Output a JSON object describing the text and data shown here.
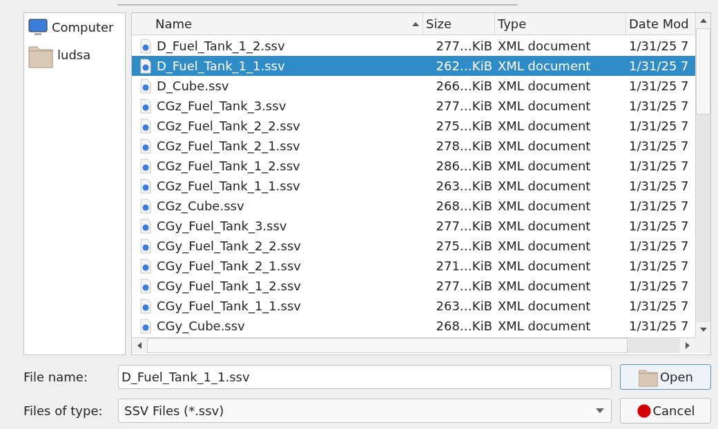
{
  "places": [
    {
      "label": "Computer",
      "kind": "computer",
      "selected": false
    },
    {
      "label": "ludsa",
      "kind": "folder",
      "selected": false
    }
  ],
  "table": {
    "columns": [
      {
        "label": "Name",
        "sorted": true
      },
      {
        "label": "Size",
        "sorted": false
      },
      {
        "label": "Type",
        "sorted": false
      },
      {
        "label": "Date Mod",
        "sorted": false
      }
    ],
    "rows": [
      {
        "name": "D_Fuel_Tank_1_2.ssv",
        "size": "277…KiB",
        "type": "XML document",
        "date": "1/31/25 7",
        "selected": false
      },
      {
        "name": "D_Fuel_Tank_1_1.ssv",
        "size": "262…KiB",
        "type": "XML document",
        "date": "1/31/25 7",
        "selected": true
      },
      {
        "name": "D_Cube.ssv",
        "size": "266…KiB",
        "type": "XML document",
        "date": "1/31/25 7",
        "selected": false
      },
      {
        "name": "CGz_Fuel_Tank_3.ssv",
        "size": "277…KiB",
        "type": "XML document",
        "date": "1/31/25 7",
        "selected": false
      },
      {
        "name": "CGz_Fuel_Tank_2_2.ssv",
        "size": "275…KiB",
        "type": "XML document",
        "date": "1/31/25 7",
        "selected": false
      },
      {
        "name": "CGz_Fuel_Tank_2_1.ssv",
        "size": "278…KiB",
        "type": "XML document",
        "date": "1/31/25 7",
        "selected": false
      },
      {
        "name": "CGz_Fuel_Tank_1_2.ssv",
        "size": "286…KiB",
        "type": "XML document",
        "date": "1/31/25 7",
        "selected": false
      },
      {
        "name": "CGz_Fuel_Tank_1_1.ssv",
        "size": "263…KiB",
        "type": "XML document",
        "date": "1/31/25 7",
        "selected": false
      },
      {
        "name": "CGz_Cube.ssv",
        "size": "268…KiB",
        "type": "XML document",
        "date": "1/31/25 7",
        "selected": false
      },
      {
        "name": "CGy_Fuel_Tank_3.ssv",
        "size": "277…KiB",
        "type": "XML document",
        "date": "1/31/25 7",
        "selected": false
      },
      {
        "name": "CGy_Fuel_Tank_2_2.ssv",
        "size": "275…KiB",
        "type": "XML document",
        "date": "1/31/25 7",
        "selected": false
      },
      {
        "name": "CGy_Fuel_Tank_2_1.ssv",
        "size": "271…KiB",
        "type": "XML document",
        "date": "1/31/25 7",
        "selected": false
      },
      {
        "name": "CGy_Fuel_Tank_1_2.ssv",
        "size": "277…KiB",
        "type": "XML document",
        "date": "1/31/25 7",
        "selected": false
      },
      {
        "name": "CGy_Fuel_Tank_1_1.ssv",
        "size": "263…KiB",
        "type": "XML document",
        "date": "1/31/25 7",
        "selected": false
      },
      {
        "name": "CGy_Cube.ssv",
        "size": "268…KiB",
        "type": "XML document",
        "date": "1/31/25 7",
        "selected": false
      }
    ]
  },
  "file_name": {
    "label": "File name:",
    "value": "D_Fuel_Tank_1_1.ssv"
  },
  "file_type": {
    "label": "Files of type:",
    "value": "SSV Files (*.ssv)"
  },
  "buttons": [
    {
      "label": "Open",
      "kind": "open",
      "default": true
    },
    {
      "label": "Cancel",
      "kind": "cancel",
      "default": false
    }
  ]
}
